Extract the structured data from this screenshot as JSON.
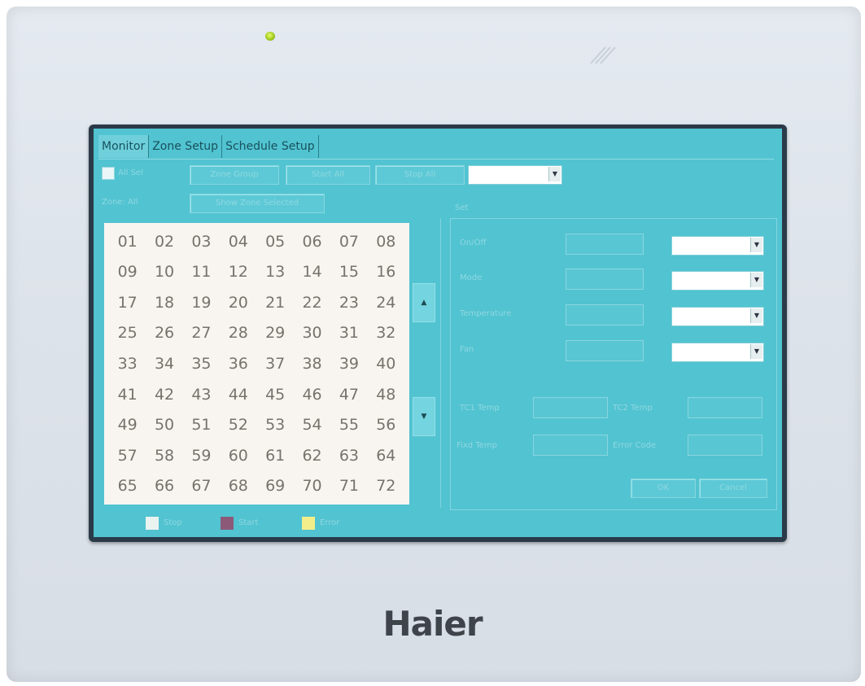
{
  "brand": {
    "name": "Haier"
  },
  "tabs": [
    {
      "label": "Monitor",
      "active": true
    },
    {
      "label": "Zone Setup",
      "active": false
    },
    {
      "label": "Schedule Setup",
      "active": false
    }
  ],
  "toolbar": {
    "select_all_label": "All Sel",
    "zone_all_label": "Zone: All",
    "group_button": "Zone Group",
    "start_all_button": "Start All",
    "stop_all_button": "Stop All",
    "show_selected_button": "Show Zone Selected",
    "group_select_value": ""
  },
  "zones": [
    "01",
    "02",
    "03",
    "04",
    "05",
    "06",
    "07",
    "08",
    "09",
    "10",
    "11",
    "12",
    "13",
    "14",
    "15",
    "16",
    "17",
    "18",
    "19",
    "20",
    "21",
    "22",
    "23",
    "24",
    "25",
    "26",
    "27",
    "28",
    "29",
    "30",
    "31",
    "32",
    "33",
    "34",
    "35",
    "36",
    "37",
    "38",
    "39",
    "40",
    "41",
    "42",
    "43",
    "44",
    "45",
    "46",
    "47",
    "48",
    "49",
    "50",
    "51",
    "52",
    "53",
    "54",
    "55",
    "56",
    "57",
    "58",
    "59",
    "60",
    "61",
    "62",
    "63",
    "64",
    "65",
    "66",
    "67",
    "68",
    "69",
    "70",
    "71",
    "72"
  ],
  "scroll": {
    "up_icon": "▲",
    "down_icon": "▼"
  },
  "panel": {
    "title": "Set",
    "rows": [
      {
        "label": "On/Off",
        "value": ""
      },
      {
        "label": "Mode",
        "value": ""
      },
      {
        "label": "Temperature",
        "value": ""
      },
      {
        "label": "Fan",
        "value": ""
      }
    ],
    "tc1_label": "TC1 Temp",
    "tc2_label": "TC2 Temp",
    "fixed_label": "Fixd Temp",
    "error_label": "Error Code",
    "ok_button": "OK",
    "cancel_button": "Cancel"
  },
  "legend": [
    {
      "label": "Stop",
      "color": "#e9f3f0"
    },
    {
      "label": "Start",
      "color": "#8c5a78"
    },
    {
      "label": "Error",
      "color": "#f2ef8a"
    }
  ],
  "colors": {
    "screen": "#52c3d1",
    "bezel": "#2a3a48",
    "zone_grid_bg": "#f8f5f0",
    "led": "#b6dc2a"
  }
}
